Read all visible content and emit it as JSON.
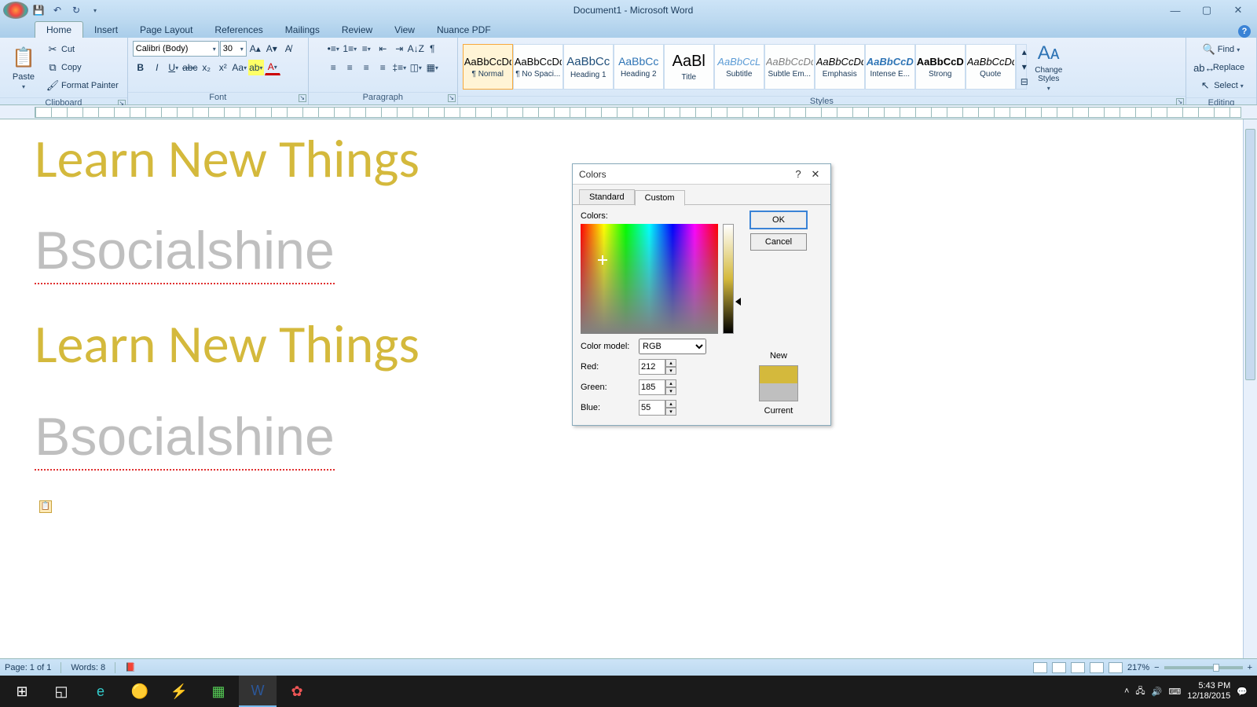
{
  "window": {
    "title": "Document1 - Microsoft Word"
  },
  "qat": {
    "save": "💾",
    "undo": "↶",
    "redo": "↻"
  },
  "tabs": [
    "Home",
    "Insert",
    "Page Layout",
    "References",
    "Mailings",
    "Review",
    "View",
    "Nuance PDF"
  ],
  "active_tab": "Home",
  "ribbon": {
    "clipboard": {
      "label": "Clipboard",
      "paste": "Paste",
      "cut": "Cut",
      "copy": "Copy",
      "fmtpainter": "Format Painter"
    },
    "font": {
      "label": "Font",
      "name": "Calibri (Body)",
      "size": "30"
    },
    "paragraph": {
      "label": "Paragraph"
    },
    "styles": {
      "label": "Styles",
      "items": [
        {
          "preview": "AaBbCcDd",
          "name": "¶ Normal",
          "style": "color:#000"
        },
        {
          "preview": "AaBbCcDd",
          "name": "¶ No Spaci...",
          "style": "color:#000"
        },
        {
          "preview": "AaBbCc",
          "name": "Heading 1",
          "style": "color:#1f4e79;font-size:15px"
        },
        {
          "preview": "AaBbCc",
          "name": "Heading 2",
          "style": "color:#2e74b5;font-size:14px"
        },
        {
          "preview": "AaBl",
          "name": "Title",
          "style": "color:#000;font-size:20px"
        },
        {
          "preview": "AaBbCcL",
          "name": "Subtitle",
          "style": "color:#5b9bd5;font-style:italic"
        },
        {
          "preview": "AaBbCcDd",
          "name": "Subtle Em...",
          "style": "color:#7f7f7f;font-style:italic"
        },
        {
          "preview": "AaBbCcDd",
          "name": "Emphasis",
          "style": "color:#000;font-style:italic"
        },
        {
          "preview": "AaBbCcDd",
          "name": "Intense E...",
          "style": "color:#2e74b5;font-style:italic;font-weight:bold"
        },
        {
          "preview": "AaBbCcDd",
          "name": "Strong",
          "style": "color:#000;font-weight:bold"
        },
        {
          "preview": "AaBbCcDd",
          "name": "Quote",
          "style": "color:#000;font-style:italic"
        }
      ],
      "change": "Change Styles"
    },
    "editing": {
      "label": "Editing",
      "find": "Find",
      "replace": "Replace",
      "select": "Select"
    }
  },
  "document": {
    "lines": [
      {
        "text": "Learn New Things",
        "cls": "gold"
      },
      {
        "text": "Bsocialshine",
        "cls": "grey",
        "squiggle": true
      },
      {
        "text": "Learn New Things",
        "cls": "gold"
      },
      {
        "text": "Bsocialshine",
        "cls": "grey",
        "squiggle": true
      }
    ]
  },
  "dialog": {
    "title": "Colors",
    "tabs": [
      "Standard",
      "Custom"
    ],
    "active_tab": "Custom",
    "colors_label": "Colors:",
    "model_label": "Color model:",
    "model_value": "RGB",
    "red_label": "Red:",
    "red_value": "212",
    "green_label": "Green:",
    "green_value": "185",
    "blue_label": "Blue:",
    "blue_value": "55",
    "ok": "OK",
    "cancel": "Cancel",
    "new": "New",
    "current": "Current",
    "new_color": "#d4b93c",
    "current_color": "#bfbfbf"
  },
  "status": {
    "page": "Page: 1 of 1",
    "words": "Words: 8",
    "zoom": "217%"
  },
  "taskbar": {
    "time": "5:43 PM",
    "date": "12/18/2015"
  }
}
